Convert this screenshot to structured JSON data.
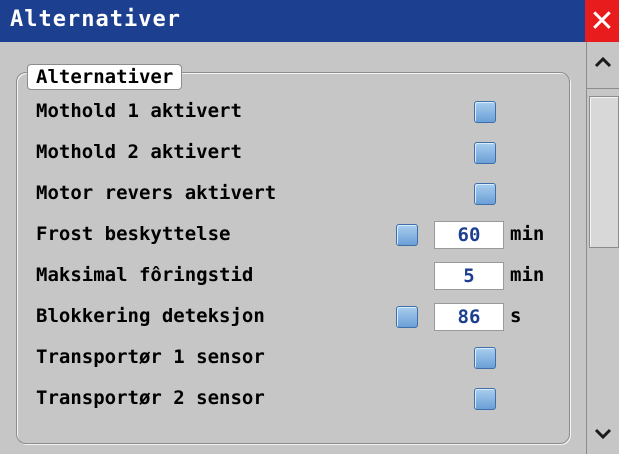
{
  "window": {
    "title": "Alternativer",
    "close_glyph": "✕"
  },
  "group": {
    "legend": "Alternativer"
  },
  "options": [
    {
      "label": "Mothold 1 aktivert",
      "checkbox": true
    },
    {
      "label": "Mothold 2 aktivert",
      "checkbox": true
    },
    {
      "label": "Motor revers aktivert",
      "checkbox": true
    },
    {
      "label": "Frost beskyttelse",
      "checkbox": true,
      "value": "60",
      "unit": "min"
    },
    {
      "label": "Maksimal fôringstid",
      "checkbox": false,
      "value": "5",
      "unit": "min"
    },
    {
      "label": "Blokkering deteksjon",
      "checkbox": true,
      "value": "86",
      "unit": "s"
    },
    {
      "label": "Transportør 1 sensor",
      "checkbox": true
    },
    {
      "label": "Transportør 2 sensor",
      "checkbox": true
    }
  ],
  "scrollbar": {
    "up_glyph": "⌃",
    "down_glyph": "⌄"
  },
  "colors": {
    "titlebar": "#1c3f8f",
    "close": "#e81c1c",
    "background": "#c6c6c6",
    "value_text": "#1c3f8f"
  }
}
